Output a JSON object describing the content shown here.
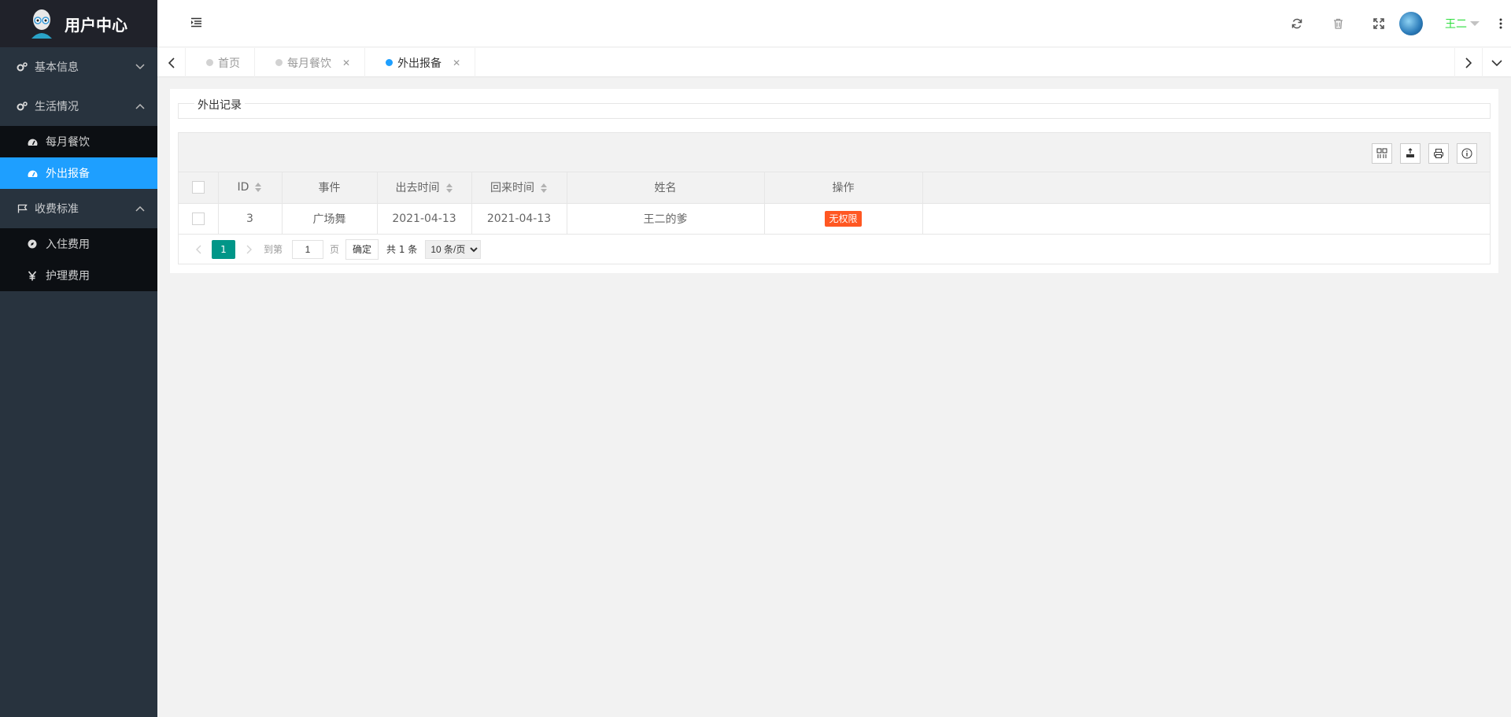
{
  "app": {
    "title": "用户中心"
  },
  "sidebar": {
    "groups": [
      {
        "label": "基本信息",
        "icon": "gears-icon",
        "expanded": false,
        "items": []
      },
      {
        "label": "生活情况",
        "icon": "gears-icon",
        "expanded": true,
        "items": [
          {
            "label": "每月餐饮",
            "icon": "dashboard-icon",
            "active": false
          },
          {
            "label": "外出报备",
            "icon": "dashboard-icon",
            "active": true
          }
        ]
      },
      {
        "label": "收费标准",
        "icon": "flag-icon",
        "expanded": true,
        "items": [
          {
            "label": "入住费用",
            "icon": "compass-icon",
            "active": false
          },
          {
            "label": "护理费用",
            "icon": "yen-icon",
            "active": false
          }
        ]
      }
    ]
  },
  "header": {
    "username": "王二"
  },
  "tabs": [
    {
      "label": "首页",
      "active": false,
      "closable": false
    },
    {
      "label": "每月餐饮",
      "active": false,
      "closable": true
    },
    {
      "label": "外出报备",
      "active": true,
      "closable": true
    }
  ],
  "panel": {
    "legend": "外出记录"
  },
  "table": {
    "columns": [
      "ID",
      "事件",
      "出去时间",
      "回来时间",
      "姓名",
      "操作"
    ],
    "rows": [
      {
        "id": "3",
        "event": "广场舞",
        "out_time": "2021-04-13",
        "back_time": "2021-04-13",
        "name": "王二的爹",
        "action": "无权限"
      }
    ]
  },
  "pager": {
    "current": "1",
    "goto_label": "到第",
    "goto_value": "1",
    "page_label": "页",
    "confirm": "确定",
    "total": "共 1 条",
    "page_size": "10 条/页"
  },
  "colors": {
    "accent": "#1e9fff",
    "pager": "#009688",
    "badge": "#ff5722",
    "sidebar": "#28333e"
  }
}
